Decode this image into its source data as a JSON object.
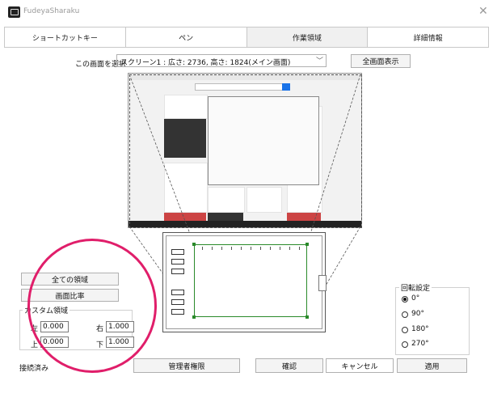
{
  "window": {
    "title": "FudeyaSharaku"
  },
  "tabs": [
    {
      "label": "ショートカットキー"
    },
    {
      "label": "ペン"
    },
    {
      "label": "作業領域"
    },
    {
      "label": "詳細情報"
    }
  ],
  "screen_select": {
    "label": "この画面を選択",
    "value": "スクリーン1 : 広さ: 2736, 高さ: 1824(メイン画面)",
    "fullscreen_button": "全画面表示"
  },
  "area_buttons": {
    "all_area": "全ての領域",
    "screen_ratio": "画面比率"
  },
  "custom_area": {
    "title": "カスタム領域",
    "left_label": "左",
    "left_value": "0.000",
    "right_label": "右",
    "right_value": "1.000",
    "top_label": "上",
    "top_value": "0.000",
    "bottom_label": "下",
    "bottom_value": "1.000"
  },
  "rotation": {
    "title": "回転設定",
    "options": [
      {
        "label": "0°",
        "selected": true
      },
      {
        "label": "90°",
        "selected": false
      },
      {
        "label": "180°",
        "selected": false
      },
      {
        "label": "270°",
        "selected": false
      }
    ]
  },
  "footer": {
    "status": "接続済み",
    "admin_button": "管理者権限",
    "ok_button": "確認",
    "cancel_button": "キャンセル",
    "apply_button": "適用"
  },
  "colors": {
    "highlight_circle": "#e01e6a",
    "active_area": "#2a8a2a"
  }
}
